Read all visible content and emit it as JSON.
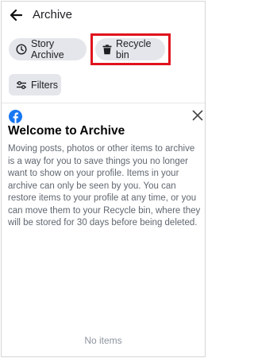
{
  "header": {
    "back_icon": "arrow-left-icon",
    "title": "Archive"
  },
  "tabs": {
    "story_archive": {
      "label": "Story Archive",
      "icon": "clock-icon"
    },
    "recycle_bin": {
      "label": "Recycle bin",
      "icon": "trash-icon",
      "highlighted": true,
      "highlight_color": "#e0131d"
    }
  },
  "filters": {
    "label": "Filters",
    "icon": "sliders-icon"
  },
  "welcome": {
    "logo": "facebook-logo",
    "logo_color": "#1877f2",
    "title": "Welcome to Archive",
    "body": "Moving posts, photos or other items to archive is a way for you to save things you no longer want to show on your profile. Items in your archive can only be seen by you. You can restore items to your profile at any time, or you can move them to your Recycle bin, where they will be stored for 30 days before being deleted.",
    "close_icon": "close-icon"
  },
  "empty_state": {
    "text": "No items"
  }
}
